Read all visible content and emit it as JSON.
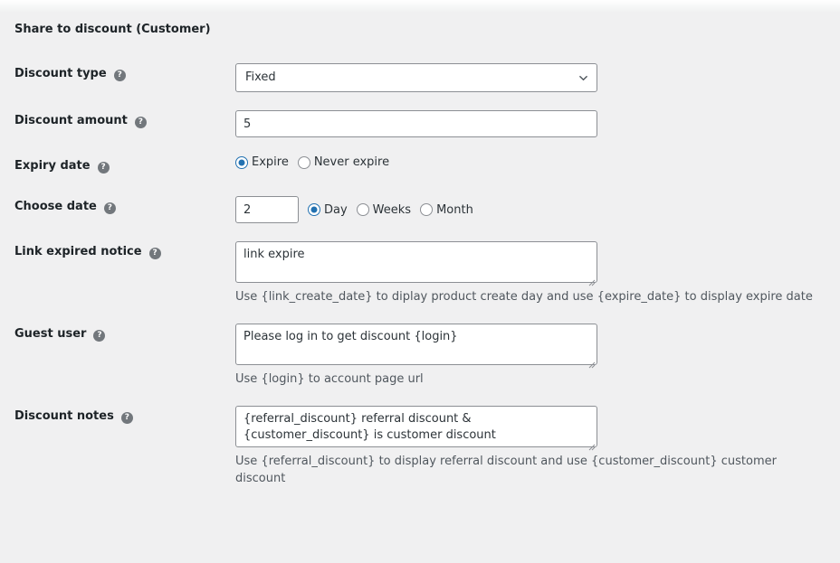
{
  "section": {
    "title": "Share to discount (Customer)"
  },
  "icons": {
    "help": "?",
    "help_name": "help-icon",
    "chevron": "chevron-down-icon",
    "resize": "resize-handle-icon"
  },
  "fields": {
    "discount_type": {
      "label": "Discount type",
      "value": "Fixed",
      "options": [
        "Fixed"
      ]
    },
    "discount_amount": {
      "label": "Discount amount",
      "value": "5"
    },
    "expiry_date": {
      "label": "Expiry date",
      "options": [
        {
          "label": "Expire",
          "checked": true
        },
        {
          "label": "Never expire",
          "checked": false
        }
      ]
    },
    "choose_date": {
      "label": "Choose date",
      "value": "2",
      "options": [
        {
          "label": "Day",
          "checked": true
        },
        {
          "label": "Weeks",
          "checked": false
        },
        {
          "label": "Month",
          "checked": false
        }
      ]
    },
    "link_expired_notice": {
      "label": "Link expired notice",
      "value": "link expire",
      "description": "Use {link_create_date} to diplay product create day and use {expire_date} to display expire date"
    },
    "guest_user": {
      "label": "Guest user",
      "value": "Please log in to get discount {login}",
      "description": "Use {login} to account page url"
    },
    "discount_notes": {
      "label": "Discount notes",
      "value": "{referral_discount} referral discount & {customer_discount} is customer discount",
      "description": "Use {referral_discount} to display referral discount and use {customer_discount} customer discount"
    }
  },
  "colors": {
    "background": "#f0f0f1",
    "text": "#1d2327",
    "muted": "#50575e",
    "border": "#8c8f94",
    "accent": "#2271b1",
    "help_icon_bg": "#72777c"
  }
}
